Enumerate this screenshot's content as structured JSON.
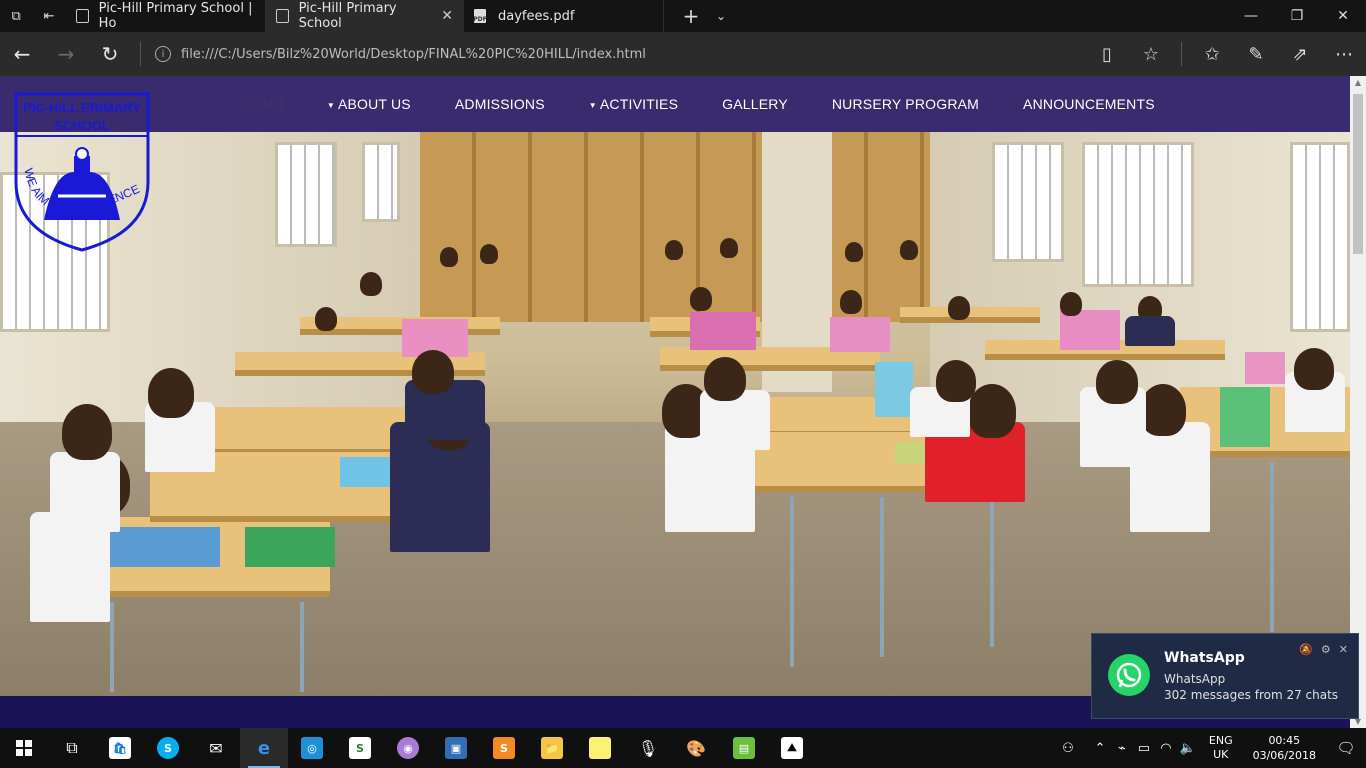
{
  "browser": {
    "tabs": [
      {
        "label": "Pic-Hill Primary School | Ho",
        "active": false
      },
      {
        "label": "Pic-Hill Primary School",
        "active": true
      },
      {
        "label": "dayfees.pdf",
        "active": false
      }
    ],
    "url": "file:///C:/Users/Bilz%20World/Desktop/FINAL%20PIC%20HILL/index.html"
  },
  "site": {
    "logo_name_line1": "PIC-HILL PRIMARY",
    "logo_name_line2": "SCHOOL",
    "logo_motto": "WE AIM AT EXCELLENCE",
    "menu": {
      "home": "HOME",
      "about": "ABOUT US",
      "admissions": "ADMISSIONS",
      "activities": "ACTIVITIES",
      "gallery": "GALLERY",
      "nursery": "NURSERY PROGRAM",
      "announcements": "ANNOUNCEMENTS"
    },
    "colors": {
      "nav_bg": "#3a2a6e",
      "logo_blue": "#1a1ad6"
    }
  },
  "toast": {
    "title": "WhatsApp",
    "app": "WhatsApp",
    "message": "302 messages from 27 chats"
  },
  "taskbar": {
    "lang_line1": "ENG",
    "lang_line2": "UK",
    "time": "00:45",
    "date": "03/06/2018"
  }
}
